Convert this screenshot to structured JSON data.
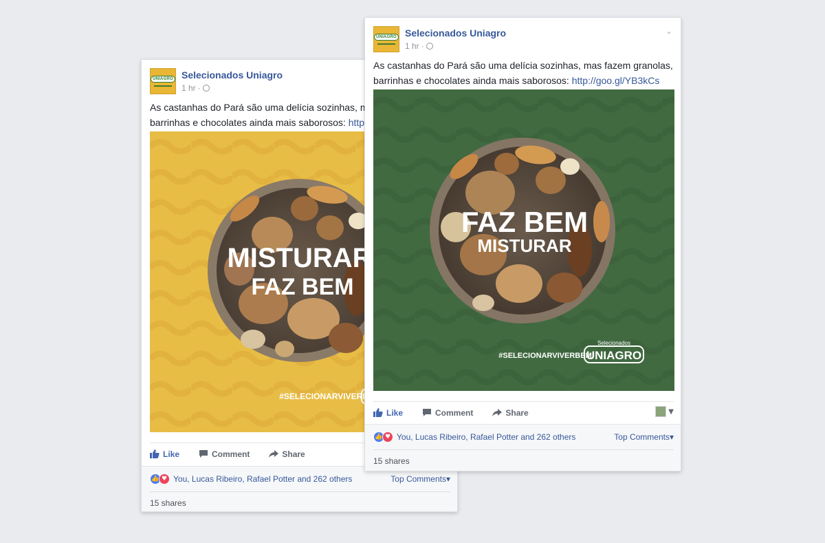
{
  "posts": [
    {
      "page_name": "Selecionados Uniagro",
      "time": "1 hr",
      "logo_text": "UNIAGRO",
      "text_line1": "As castanhas do Pará são uma delícia sozinhas, mas f",
      "text_line2_prefix": "barrinhas e chocolates ainda mais saborosos: ",
      "link": "http://goo",
      "image": {
        "headline_line1": "MISTURAR",
        "headline_line2": "FAZ BEM",
        "hashtag": "#SELECIONARVIVERBEM",
        "bg_color": "#e8bd45"
      },
      "actions": {
        "like": "Like",
        "comment": "Comment",
        "share": "Share"
      },
      "reactions_text": "You, Lucas Ribeiro, Rafael Potter and 262 others",
      "top_comments": "Top Comments",
      "shares": "15 shares"
    },
    {
      "page_name": "Selecionados Uniagro",
      "time": "1 hr",
      "logo_text": "UNIAGRO",
      "text_line1": "As castanhas do Pará são uma delícia sozinhas, mas fazem granolas,",
      "text_line2_prefix": "barrinhas e chocolates ainda mais saborosos: ",
      "link": "http://goo.gl/YB3kCs",
      "image": {
        "headline_line1": "FAZ BEM",
        "headline_line2": "MISTURAR",
        "hashtag": "#SELECIONARVIVERBEM",
        "brand_small": "Selecionados",
        "brand": "UNIAGRO",
        "bg_color": "#416a41"
      },
      "actions": {
        "like": "Like",
        "comment": "Comment",
        "share": "Share"
      },
      "reactions_text": "You, Lucas Ribeiro, Rafael Potter and 262 others",
      "top_comments": "Top Comments",
      "shares": "15 shares"
    }
  ],
  "colors": {
    "page_bg": "#e9ebee",
    "link": "#365899",
    "like_blue": "#4267b2",
    "love_red": "#ed4459"
  }
}
